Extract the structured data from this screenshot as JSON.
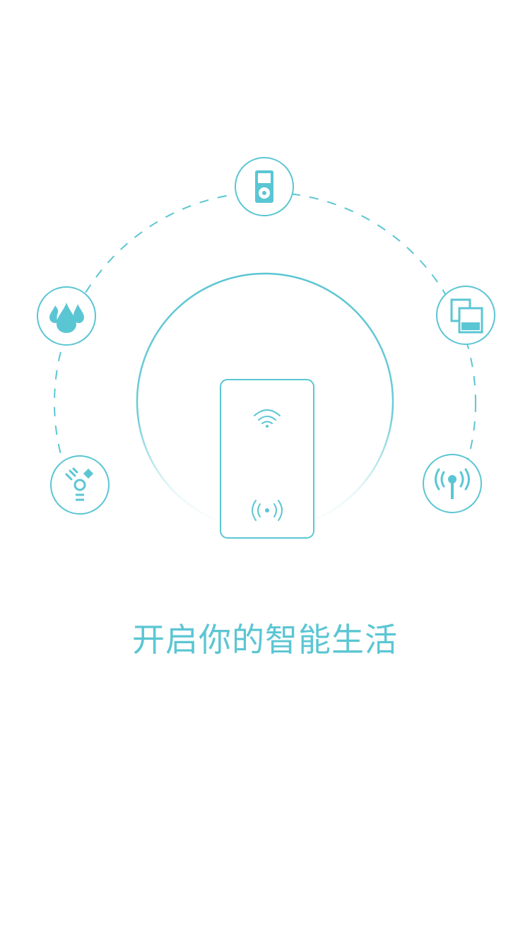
{
  "screen": {
    "tagline": "开启你的智能生活"
  },
  "theme": {
    "accent": "#5bc6d3",
    "background": "#ffffff"
  },
  "icons": {
    "top": "ipod-icon",
    "left_upper": "water-drops-icon",
    "right_upper": "copy-pages-icon",
    "left_lower": "firewire-icon",
    "right_lower": "broadcast-antenna-icon",
    "center_device": "smart-socket-device",
    "center_wifi": "wifi-icon",
    "center_signal": "nfc-signal-icon"
  }
}
